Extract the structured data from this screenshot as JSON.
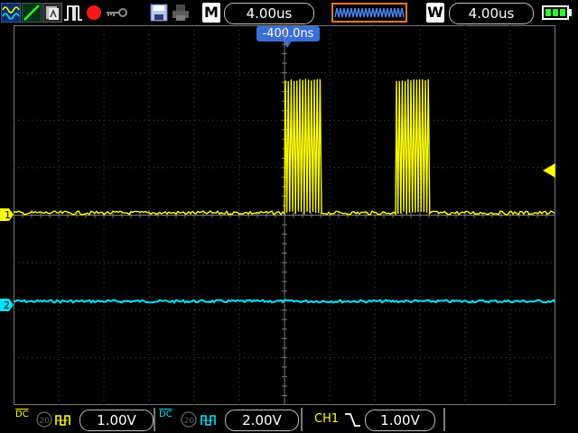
{
  "toolbar": {
    "icons": [
      "wave-icon",
      "slope-icon",
      "persistence-icon",
      "pulse-icon",
      "record-icon",
      "key-icon",
      "save-icon",
      "print-icon"
    ],
    "main_tag": "M",
    "main_timebase": "4.00us",
    "window_tag": "W",
    "window_timebase": "4.00us"
  },
  "display": {
    "trigger_offset": "-400.0ns",
    "ch1_marker": "1",
    "ch2_marker": "2",
    "colors": {
      "ch1": "#ffff00",
      "ch2": "#00e5ff",
      "grid": "#4a4a4a"
    }
  },
  "footer": {
    "ch1": {
      "coupling": "DC",
      "bw": "20",
      "scale": "1.00V"
    },
    "ch2": {
      "coupling": "DC",
      "bw": "20",
      "scale": "2.00V"
    },
    "trigger": {
      "source": "CH1",
      "slope": "falling",
      "level": "1.00V"
    }
  }
}
